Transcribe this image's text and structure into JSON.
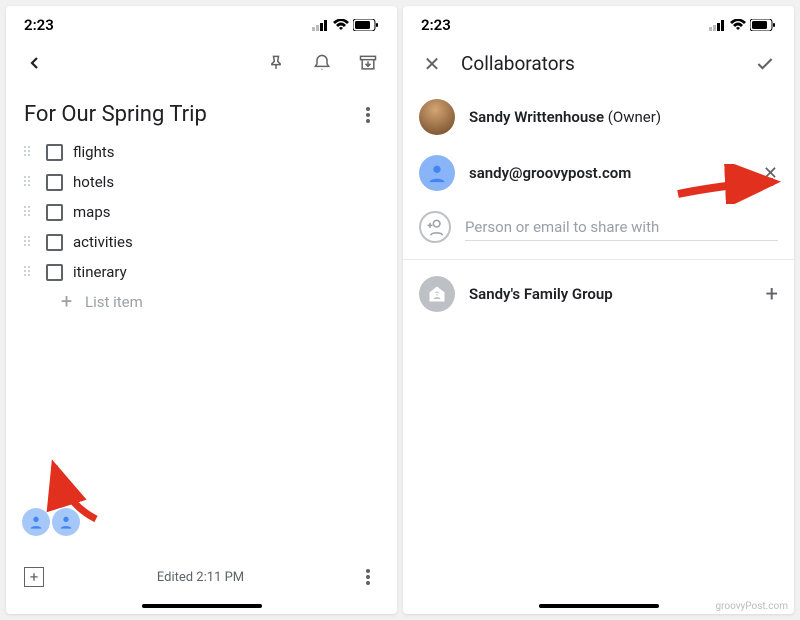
{
  "status": {
    "time": "2:23"
  },
  "left": {
    "title": "For Our Spring Trip",
    "items": [
      "flights",
      "hotels",
      "maps",
      "activities",
      "itinerary"
    ],
    "add_placeholder": "List item",
    "edited": "Edited 2:11 PM"
  },
  "right": {
    "title": "Collaborators",
    "owner_name": "Sandy Writtenhouse",
    "owner_suffix": " (Owner)",
    "collab_email": "sandy@groovypost.com",
    "input_placeholder": "Person or email to share with",
    "group_name": "Sandy's Family Group"
  },
  "watermark": "groovyPost.com"
}
